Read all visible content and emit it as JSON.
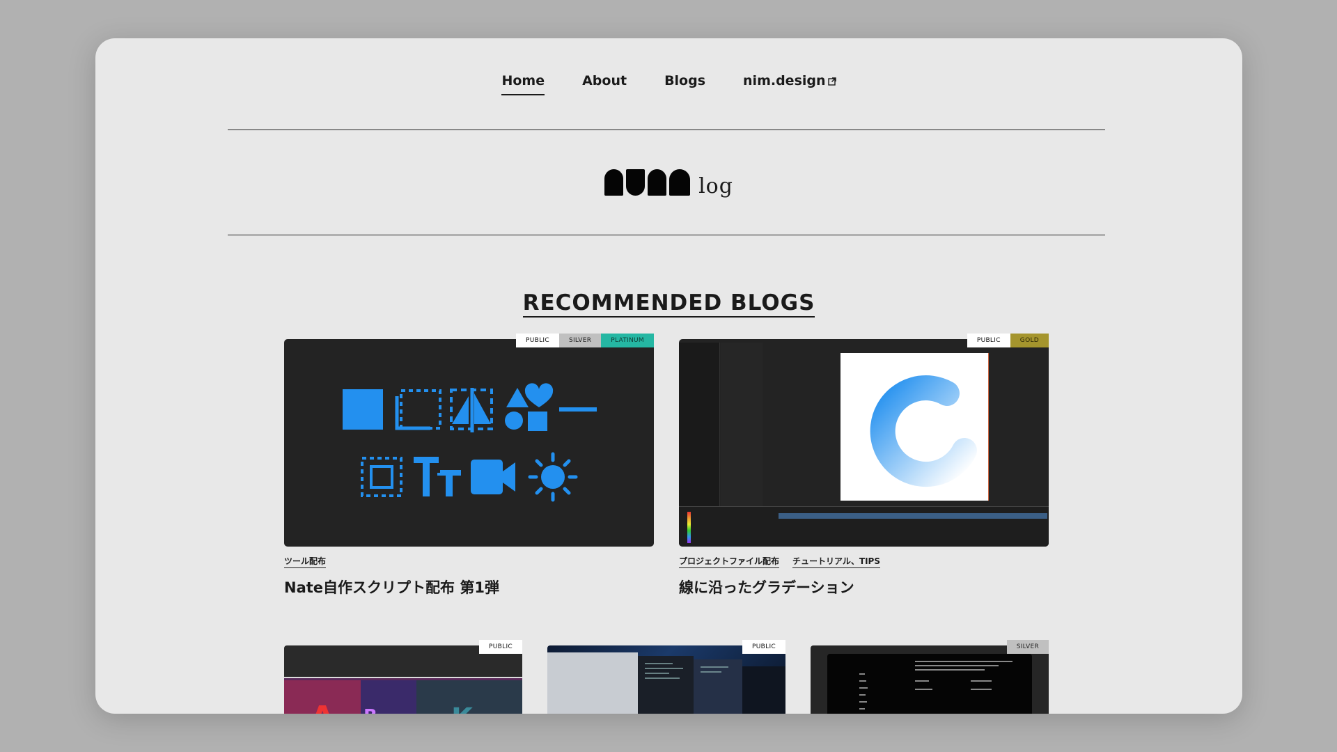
{
  "nav": {
    "items": [
      {
        "label": "Home",
        "active": true
      },
      {
        "label": "About",
        "active": false
      },
      {
        "label": "Blogs",
        "active": false
      },
      {
        "label": "nim.design",
        "active": false,
        "external": true
      }
    ]
  },
  "logo": {
    "text": "log"
  },
  "section": {
    "title": "RECOMMENDED BLOGS"
  },
  "cards": [
    {
      "badges": [
        "PUBLIC",
        "SILVER",
        "PLATINUM"
      ],
      "tags": [
        "ツール配布"
      ],
      "title": "Nate自作スクリプト配布 第1弾"
    },
    {
      "badges": [
        "PUBLIC",
        "GOLD"
      ],
      "tags": [
        "プロジェクトファイル配布",
        "チュートリアル、TIPS"
      ],
      "title": "線に沿ったグラデーション"
    }
  ],
  "small_cards": [
    {
      "badges": [
        "PUBLIC"
      ]
    },
    {
      "badges": [
        "PUBLIC"
      ]
    },
    {
      "badges": [
        "SILVER"
      ]
    }
  ],
  "colors": {
    "background": "#b1b1b1",
    "page": "#e8e8e8",
    "icon_blue": "#2390ef",
    "badge_platinum": "#25b7a3",
    "badge_gold": "#a5952d",
    "badge_silver": "#c0c0c0"
  }
}
